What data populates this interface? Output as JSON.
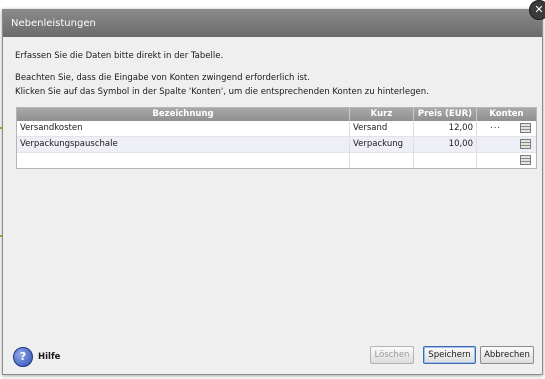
{
  "window": {
    "title": "Nebenleistungen",
    "close_glyph": "✕"
  },
  "instructions": {
    "line1": "Erfassen Sie die Daten bitte direkt in der Tabelle.",
    "line2": "Beachten Sie, dass die Eingabe von Konten zwingend erforderlich ist.",
    "line3": "Klicken Sie auf das Symbol in der Spalte 'Konten', um die entsprechenden Konten zu  hinterlegen."
  },
  "table": {
    "headers": {
      "bezeichnung": "Bezeichnung",
      "kurz": "Kurz",
      "preis": "Preis (EUR)",
      "konten": "Konten"
    },
    "rows": [
      {
        "bezeichnung": "Versandkosten",
        "kurz": "Versand",
        "preis": "12,00",
        "konten": "..."
      },
      {
        "bezeichnung": "Verpackungspauschale",
        "kurz": "Verpackung",
        "preis": "10,00",
        "konten": ""
      },
      {
        "bezeichnung": "",
        "kurz": "",
        "preis": "",
        "konten": ""
      }
    ],
    "konten_icon": "account-table-icon"
  },
  "footer": {
    "help_glyph": "?",
    "help_label": "Hilfe",
    "delete_label": "Löschen",
    "save_label": "Speichern",
    "cancel_label": "Abbrechen"
  },
  "colors": {
    "callout": "#9bbe2c",
    "title_bar": "#7b7b7b",
    "header": "#9c9c9c"
  }
}
